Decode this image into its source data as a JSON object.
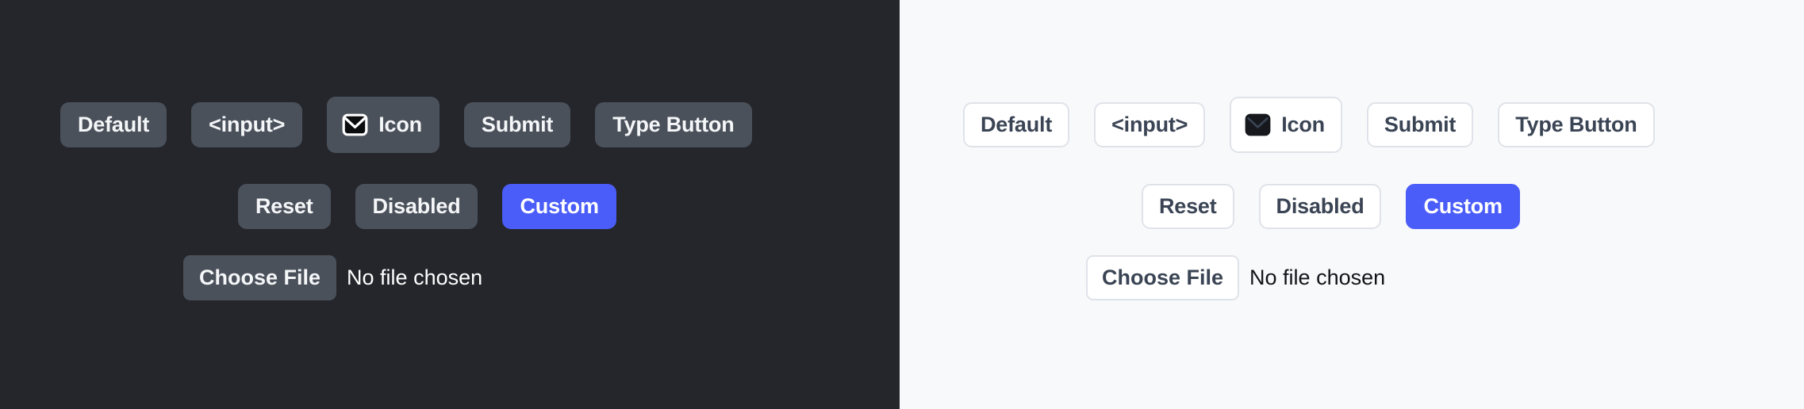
{
  "meta": {
    "description": "Side-by-side comparison of HTML button variants rendered in dark theme and light theme"
  },
  "colors": {
    "dark_background": "#24262b",
    "light_background": "#f8f9fb",
    "dark_button_fill": "#4b515b",
    "dark_button_text": "#f4f6f8",
    "light_button_fill": "#ffffff",
    "light_button_border": "#dfe3e9",
    "light_button_text": "#3a4454",
    "accent": "#4a5df9",
    "accent_text": "#ffffff"
  },
  "panels": [
    {
      "theme": "dark",
      "rows": [
        {
          "name": "primary-button-row",
          "buttons": [
            {
              "label": "Default",
              "variant": "default",
              "icon": null
            },
            {
              "label": "<input>",
              "variant": "default",
              "icon": null
            },
            {
              "label": "Icon",
              "variant": "icon",
              "icon": "envelope-icon"
            },
            {
              "label": "Submit",
              "variant": "default",
              "icon": null
            },
            {
              "label": "Type Button",
              "variant": "default",
              "icon": null
            }
          ]
        },
        {
          "name": "secondary-button-row",
          "buttons": [
            {
              "label": "Reset",
              "variant": "default",
              "icon": null
            },
            {
              "label": "Disabled",
              "variant": "default",
              "icon": null
            },
            {
              "label": "Custom",
              "variant": "accent",
              "icon": null
            }
          ]
        },
        {
          "name": "file-input-row",
          "file_input": {
            "button_label": "Choose File",
            "status_text": "No file chosen"
          }
        }
      ]
    },
    {
      "theme": "light",
      "rows": [
        {
          "name": "primary-button-row",
          "buttons": [
            {
              "label": "Default",
              "variant": "default",
              "icon": null
            },
            {
              "label": "<input>",
              "variant": "default",
              "icon": null
            },
            {
              "label": "Icon",
              "variant": "icon",
              "icon": "envelope-icon"
            },
            {
              "label": "Submit",
              "variant": "default",
              "icon": null
            },
            {
              "label": "Type Button",
              "variant": "default",
              "icon": null
            }
          ]
        },
        {
          "name": "secondary-button-row",
          "buttons": [
            {
              "label": "Reset",
              "variant": "default",
              "icon": null
            },
            {
              "label": "Disabled",
              "variant": "default",
              "icon": null
            },
            {
              "label": "Custom",
              "variant": "accent",
              "icon": null
            }
          ]
        },
        {
          "name": "file-input-row",
          "file_input": {
            "button_label": "Choose File",
            "status_text": "No file chosen"
          }
        }
      ]
    }
  ]
}
